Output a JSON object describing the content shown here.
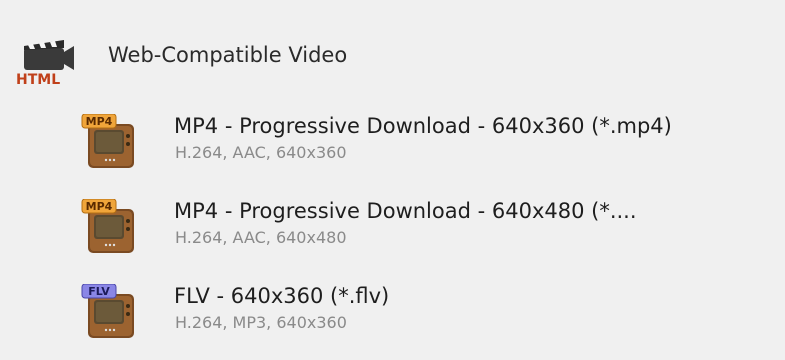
{
  "category": {
    "label": "Web-Compatible Video",
    "icon": "html-video-icon",
    "icon_text": "HTML"
  },
  "items": [
    {
      "title": "MP4 - Progressive Download - 640x360 (*.mp4)",
      "subtitle": "H.264, AAC, 640x360",
      "badge": "MP4",
      "badge_color": "#f0a53a",
      "icon": "mp4-tv-icon"
    },
    {
      "title": "MP4 - Progressive Download - 640x480 (*....",
      "subtitle": "H.264, AAC, 640x480",
      "badge": "MP4",
      "badge_color": "#f0a53a",
      "icon": "mp4-tv-icon"
    },
    {
      "title": "FLV - 640x360 (*.flv)",
      "subtitle": "H.264, MP3, 640x360",
      "badge": "FLV",
      "badge_color": "#8a86e6",
      "icon": "flv-tv-icon"
    }
  ]
}
